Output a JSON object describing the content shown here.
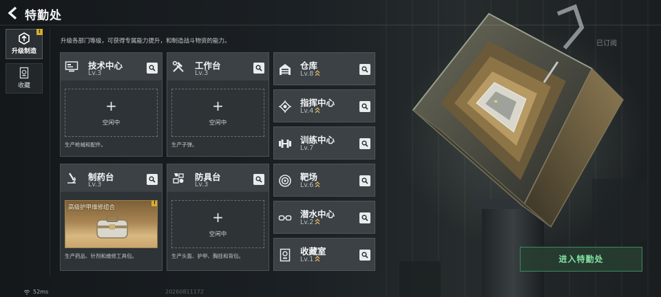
{
  "header": {
    "title": "特勤处",
    "subscribed": "已订阅"
  },
  "nav": [
    {
      "label": "升级制造",
      "icon": "upgrade-craft-icon",
      "active": true,
      "badge": "!"
    },
    {
      "label": "收藏",
      "icon": "collection-icon",
      "active": false
    }
  ],
  "subtitle": "升级各部门等级，可获得专属能力提升，和制造战斗物资的能力。",
  "cards": [
    {
      "name": "技术中心",
      "level": "Lv.3",
      "icon": "tech-monitor-icon",
      "slot": "空闲中",
      "desc": "生产枪械和配件。"
    },
    {
      "name": "工作台",
      "level": "Lv.3",
      "icon": "hammer-wrench-icon",
      "slot": "空闲中",
      "desc": "生产子弹。"
    },
    {
      "name": "制药台",
      "level": "Lv.3",
      "icon": "microscope-icon",
      "craft": "高级护甲维修组合",
      "badge": "!",
      "desc": "生产药品、针剂和维修工具包。"
    },
    {
      "name": "防具台",
      "level": "Lv.3",
      "icon": "armor-parts-icon",
      "slot": "空闲中",
      "desc": "生产头盔、护甲、胸挂和背包。"
    }
  ],
  "facilities": [
    {
      "name": "仓库",
      "level": "Lv.8",
      "icon": "warehouse-icon"
    },
    {
      "name": "指挥中心",
      "level": "Lv.4",
      "icon": "command-chip-icon"
    },
    {
      "name": "训练中心",
      "level": "Lv.7",
      "icon": "dumbbell-icon"
    },
    {
      "name": "靶场",
      "level": "Lv.6",
      "icon": "target-icon"
    },
    {
      "name": "潜水中心",
      "level": "Lv.2",
      "icon": "diving-goggles-icon"
    },
    {
      "name": "收藏室",
      "level": "Lv.1",
      "icon": "collection-room-icon"
    }
  ],
  "enter_button": "进入特勤处",
  "footer": {
    "ping": "52ms",
    "id": "20260811172"
  },
  "colors": {
    "accent_green": "#83e3a4",
    "badge_yellow": "#d7ad2f",
    "upgrade_arrow": "#d8b464"
  }
}
